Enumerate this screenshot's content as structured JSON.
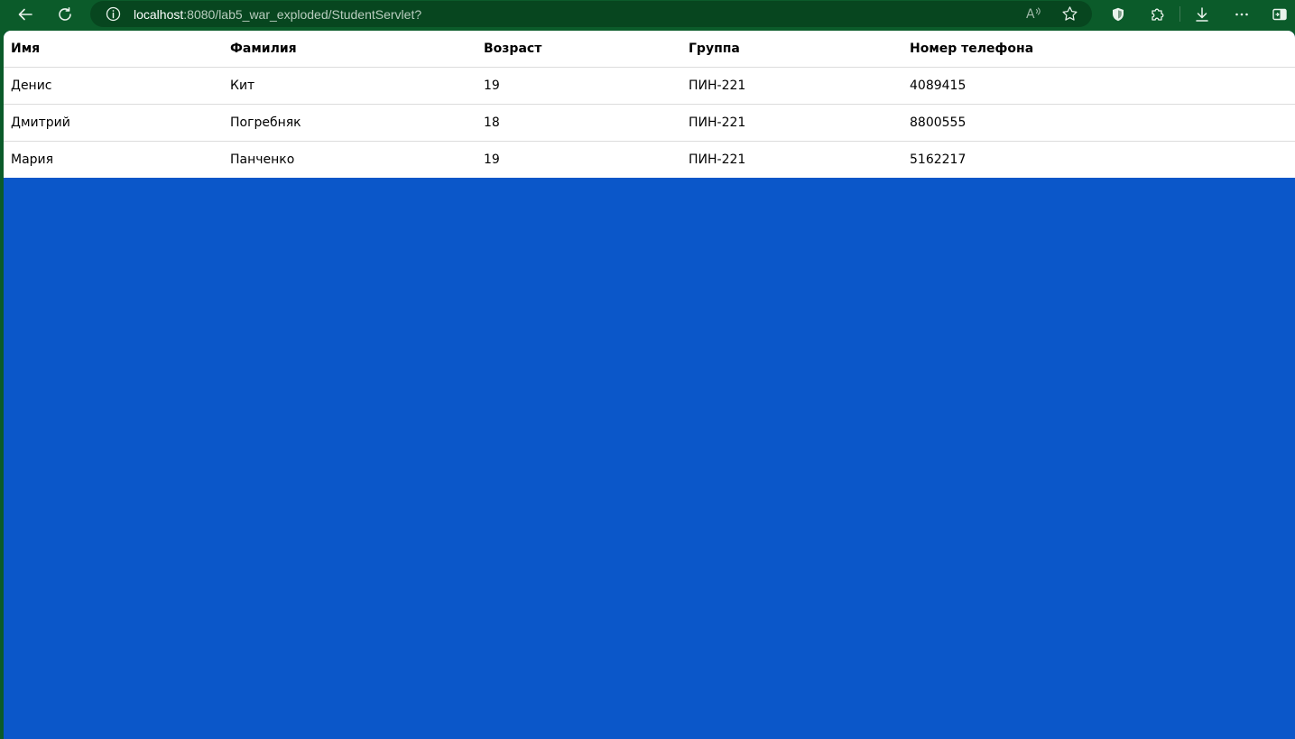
{
  "browser": {
    "address_bar": {
      "url_host": "localhost",
      "url_rest": ":8080/lab5_war_exploded/StudentServlet?"
    },
    "icons": {
      "back": "arrow-left-icon",
      "refresh": "refresh-icon",
      "site_info": "info-circle-icon",
      "read_aloud": "read-aloud-icon",
      "favorite": "star-icon",
      "shield": "shield-icon",
      "extensions": "puzzle-icon",
      "downloads": "download-icon",
      "menu": "more-dots-icon",
      "sidebar": "sidebar-icon"
    },
    "colors": {
      "frame": "#0b5b2a",
      "address_bg": "#07461f",
      "page_bg": "#0b57c9"
    }
  },
  "table": {
    "headers": [
      "Имя",
      "Фамилия",
      "Возраст",
      "Группа",
      "Номер телефона"
    ],
    "rows": [
      [
        "Денис",
        "Кит",
        "19",
        "ПИН-221",
        "4089415"
      ],
      [
        "Дмитрий",
        "Погребняк",
        "18",
        "ПИН-221",
        "8800555"
      ],
      [
        "Мария",
        "Панченко",
        "19",
        "ПИН-221",
        "5162217"
      ]
    ]
  }
}
